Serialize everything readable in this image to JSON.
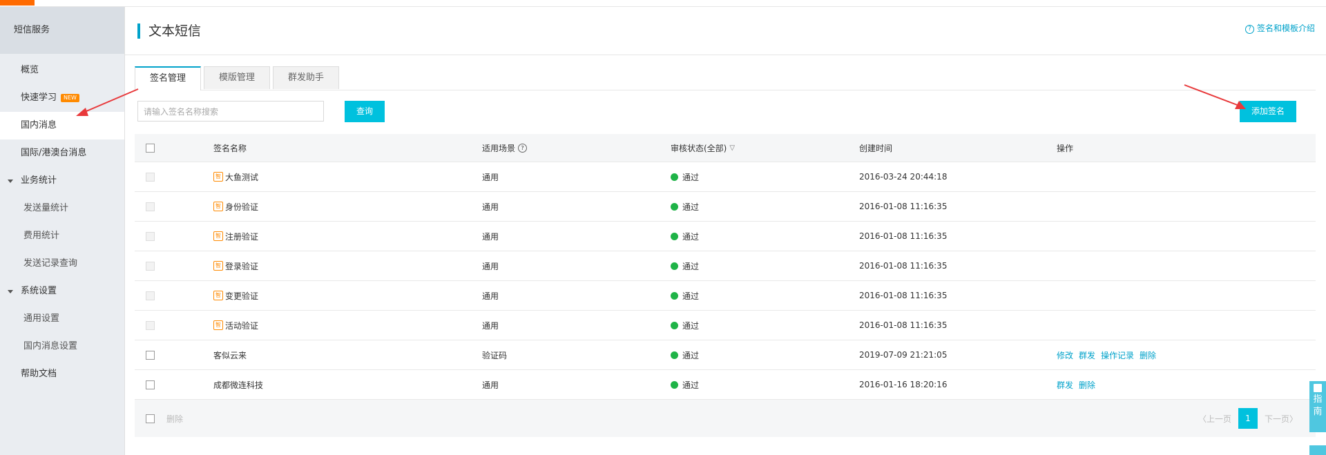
{
  "sidebar": {
    "header": "短信服务",
    "items": [
      {
        "label": "概览"
      },
      {
        "label": "快速学习",
        "badge": "NEW"
      },
      {
        "label": "国内消息"
      },
      {
        "label": "国际/港澳台消息"
      }
    ],
    "group_business": "业务统计",
    "business_items": [
      "发送量统计",
      "费用统计",
      "发送记录查询"
    ],
    "group_settings": "系统设置",
    "settings_items": [
      "通用设置",
      "国内消息设置"
    ],
    "help": "帮助文档"
  },
  "header": {
    "title": "文本短信",
    "help_link": "签名和模板介绍"
  },
  "tabs": [
    "签名管理",
    "模版管理",
    "群发助手"
  ],
  "search": {
    "placeholder": "请输入签名名称搜索",
    "button": "查询"
  },
  "add_button": "添加签名",
  "table": {
    "columns": [
      "签名名称",
      "适用场景",
      "审核状态(全部)",
      "创建时间",
      "操作"
    ],
    "rows": [
      {
        "name": "大鱼测试",
        "tag": "智",
        "scene": "通用",
        "status": "通过",
        "time": "2016-03-24 20:44:18",
        "ops": []
      },
      {
        "name": "身份验证",
        "tag": "智",
        "scene": "通用",
        "status": "通过",
        "time": "2016-01-08 11:16:35",
        "ops": []
      },
      {
        "name": "注册验证",
        "tag": "智",
        "scene": "通用",
        "status": "通过",
        "time": "2016-01-08 11:16:35",
        "ops": []
      },
      {
        "name": "登录验证",
        "tag": "智",
        "scene": "通用",
        "status": "通过",
        "time": "2016-01-08 11:16:35",
        "ops": []
      },
      {
        "name": "变更验证",
        "tag": "智",
        "scene": "通用",
        "status": "通过",
        "time": "2016-01-08 11:16:35",
        "ops": []
      },
      {
        "name": "活动验证",
        "tag": "智",
        "scene": "通用",
        "status": "通过",
        "time": "2016-01-08 11:16:35",
        "ops": []
      },
      {
        "name": "客似云来",
        "tag": "",
        "scene": "验证码",
        "status": "通过",
        "time": "2019-07-09 21:21:05",
        "ops": [
          "修改",
          "群发",
          "操作记录",
          "删除"
        ]
      },
      {
        "name": "成都微连科技",
        "tag": "",
        "scene": "通用",
        "status": "通过",
        "time": "2016-01-16 18:20:16",
        "ops": [
          "群发",
          "删除"
        ]
      }
    ]
  },
  "footer": {
    "delete": "删除",
    "prev": "上一页",
    "page": "1",
    "next": "下一页"
  },
  "guide": "指南",
  "colors": {
    "accent": "#00c1de",
    "link": "#00a2ca",
    "success": "#1fb347",
    "tag": "#ff8a00",
    "annotation": "#e8393b"
  }
}
